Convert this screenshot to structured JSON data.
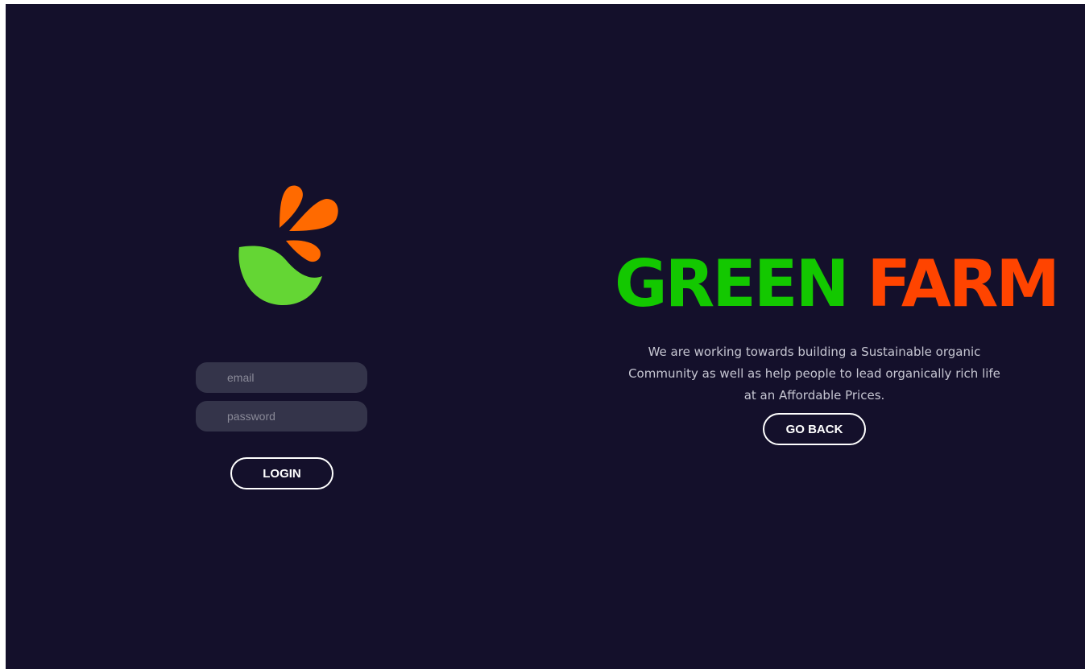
{
  "login": {
    "email_placeholder": "email",
    "password_placeholder": "password",
    "login_label": "LOGIN"
  },
  "brand": {
    "word_1": "GREEN",
    "word_2": "FARM",
    "tagline_line_1": "We are working towards building a Sustainable organic",
    "tagline_line_2": "Community as well as help people to lead organically rich life",
    "tagline_line_3": "at an Affordable Prices.",
    "go_back_label": "GO BACK"
  },
  "colors": {
    "background": "#14102b",
    "green": "#13c800",
    "orange": "#ff4400",
    "logo_orange": "#ff6a00",
    "logo_green": "#64d634",
    "input_bg": "#34344a"
  },
  "icons": {
    "logo": "green-farm-logo-icon"
  }
}
